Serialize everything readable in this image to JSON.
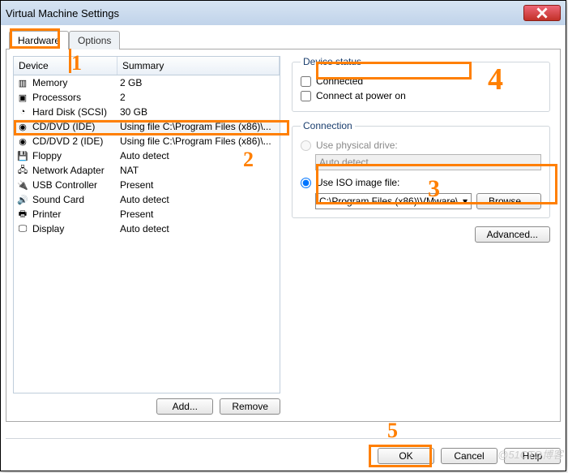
{
  "window": {
    "title": "Virtual Machine Settings"
  },
  "tabs": {
    "hardware": "Hardware",
    "options": "Options"
  },
  "columns": {
    "device": "Device",
    "summary": "Summary"
  },
  "devices": [
    {
      "icon": "memory-icon",
      "name": "Memory",
      "summary": "2 GB"
    },
    {
      "icon": "cpu-icon",
      "name": "Processors",
      "summary": "2"
    },
    {
      "icon": "disk-icon",
      "name": "Hard Disk (SCSI)",
      "summary": "30 GB"
    },
    {
      "icon": "cd-icon",
      "name": "CD/DVD (IDE)",
      "summary": "Using file C:\\Program Files (x86)\\...",
      "selected": true
    },
    {
      "icon": "cd-icon",
      "name": "CD/DVD 2 (IDE)",
      "summary": "Using file C:\\Program Files (x86)\\..."
    },
    {
      "icon": "floppy-icon",
      "name": "Floppy",
      "summary": "Auto detect"
    },
    {
      "icon": "net-icon",
      "name": "Network Adapter",
      "summary": "NAT"
    },
    {
      "icon": "usb-icon",
      "name": "USB Controller",
      "summary": "Present"
    },
    {
      "icon": "sound-icon",
      "name": "Sound Card",
      "summary": "Auto detect"
    },
    {
      "icon": "printer-icon",
      "name": "Printer",
      "summary": "Present"
    },
    {
      "icon": "display-icon",
      "name": "Display",
      "summary": "Auto detect"
    }
  ],
  "left_buttons": {
    "add": "Add...",
    "remove": "Remove"
  },
  "device_status": {
    "legend": "Device status",
    "connected": "Connected",
    "connect_power": "Connect at power on"
  },
  "connection": {
    "legend": "Connection",
    "physical": "Use physical drive:",
    "physical_value": "Auto detect",
    "iso_label": "Use ISO image file:",
    "iso_value": "C:\\Program Files (x86)\\VMware\\",
    "browse": "Browse..."
  },
  "advanced": "Advanced...",
  "footer": {
    "ok": "OK",
    "cancel": "Cancel",
    "help": "Help"
  },
  "annotations": {
    "a1": "1",
    "a2": "2",
    "a3": "3",
    "a4": "4",
    "a5": "5"
  },
  "watermark": "@51CTO博客"
}
